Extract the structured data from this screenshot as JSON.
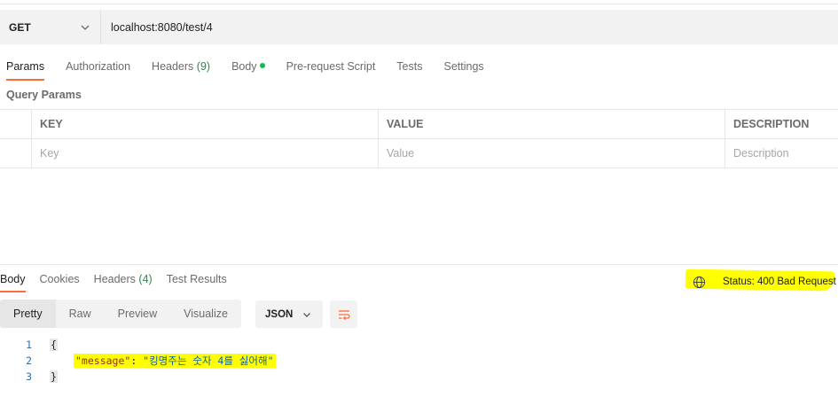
{
  "request": {
    "method": "GET",
    "url": "localhost:8080/test/4"
  },
  "request_tabs": [
    {
      "label": "Params"
    },
    {
      "label": "Authorization"
    },
    {
      "label": "Headers",
      "count": "(9)"
    },
    {
      "label": "Body"
    },
    {
      "label": "Pre-request Script"
    },
    {
      "label": "Tests"
    },
    {
      "label": "Settings"
    }
  ],
  "query_params": {
    "title": "Query Params",
    "headers": {
      "key": "KEY",
      "value": "VALUE",
      "description": "DESCRIPTION"
    },
    "placeholders": {
      "key": "Key",
      "value": "Value",
      "description": "Description"
    }
  },
  "response_tabs": [
    {
      "label": "Body"
    },
    {
      "label": "Cookies"
    },
    {
      "label": "Headers",
      "count": "(4)"
    },
    {
      "label": "Test Results"
    }
  ],
  "status": {
    "text": "Status: 400 Bad Request",
    "highlight_color": "#ffff00"
  },
  "view_modes": [
    "Pretty",
    "Raw",
    "Preview",
    "Visualize"
  ],
  "format": "JSON",
  "code": {
    "line_numbers": [
      "1",
      "2",
      "3"
    ],
    "open_brace": "{",
    "key": "\"message\"",
    "colon": ": ",
    "value": "\"킹명주는 숫자 4를 싫어해\"",
    "close_brace": "}"
  },
  "colors": {
    "accent": "#ff6c37",
    "count_green": "#2a8b4a",
    "body_dot": "#0cbb52",
    "highlight": "#ffff00"
  }
}
